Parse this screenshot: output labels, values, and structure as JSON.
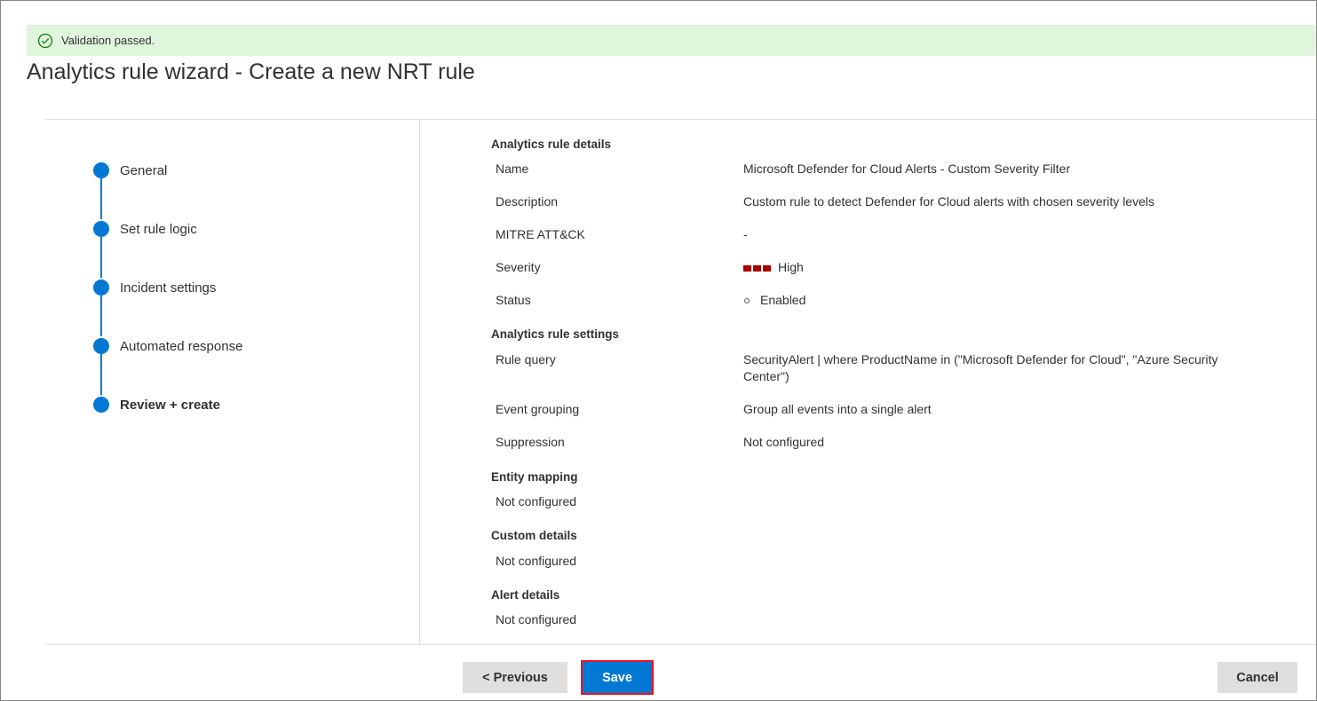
{
  "banner": {
    "icon": "check-circle-icon",
    "text": "Validation passed."
  },
  "page_title": "Analytics rule wizard - Create a new NRT rule",
  "steps": [
    {
      "label": "General",
      "active": false
    },
    {
      "label": "Set rule logic",
      "active": false
    },
    {
      "label": "Incident settings",
      "active": false
    },
    {
      "label": "Automated response",
      "active": false
    },
    {
      "label": "Review + create",
      "active": true
    }
  ],
  "details": {
    "title": "Analytics rule details",
    "rows": [
      {
        "label": "Name",
        "value": "Microsoft Defender for Cloud Alerts - Custom Severity Filter"
      },
      {
        "label": "Description",
        "value": "Custom rule to detect Defender for Cloud alerts with chosen severity levels"
      },
      {
        "label": "MITRE ATT&CK",
        "value": "-"
      },
      {
        "label": "Severity",
        "value": "High"
      },
      {
        "label": "Status",
        "value": "Enabled"
      }
    ]
  },
  "settings": {
    "title": "Analytics rule settings",
    "rows": [
      {
        "label": "Rule query",
        "value": "SecurityAlert | where ProductName in (\"Microsoft Defender for Cloud\", \"Azure Security Center\")"
      },
      {
        "label": "Event grouping",
        "value": "Group all events into a single alert"
      },
      {
        "label": "Suppression",
        "value": "Not configured"
      }
    ]
  },
  "entity_mapping": {
    "title": "Entity mapping",
    "value": "Not configured"
  },
  "custom_details": {
    "title": "Custom details",
    "value": "Not configured"
  },
  "alert_details": {
    "title": "Alert details",
    "value": "Not configured"
  },
  "buttons": {
    "previous": "< Previous",
    "save": "Save",
    "cancel": "Cancel"
  },
  "colors": {
    "accent": "#0078d4",
    "banner_bg": "#dff6dd",
    "severity_high": "#a80000",
    "save_highlight": "#e81123"
  }
}
